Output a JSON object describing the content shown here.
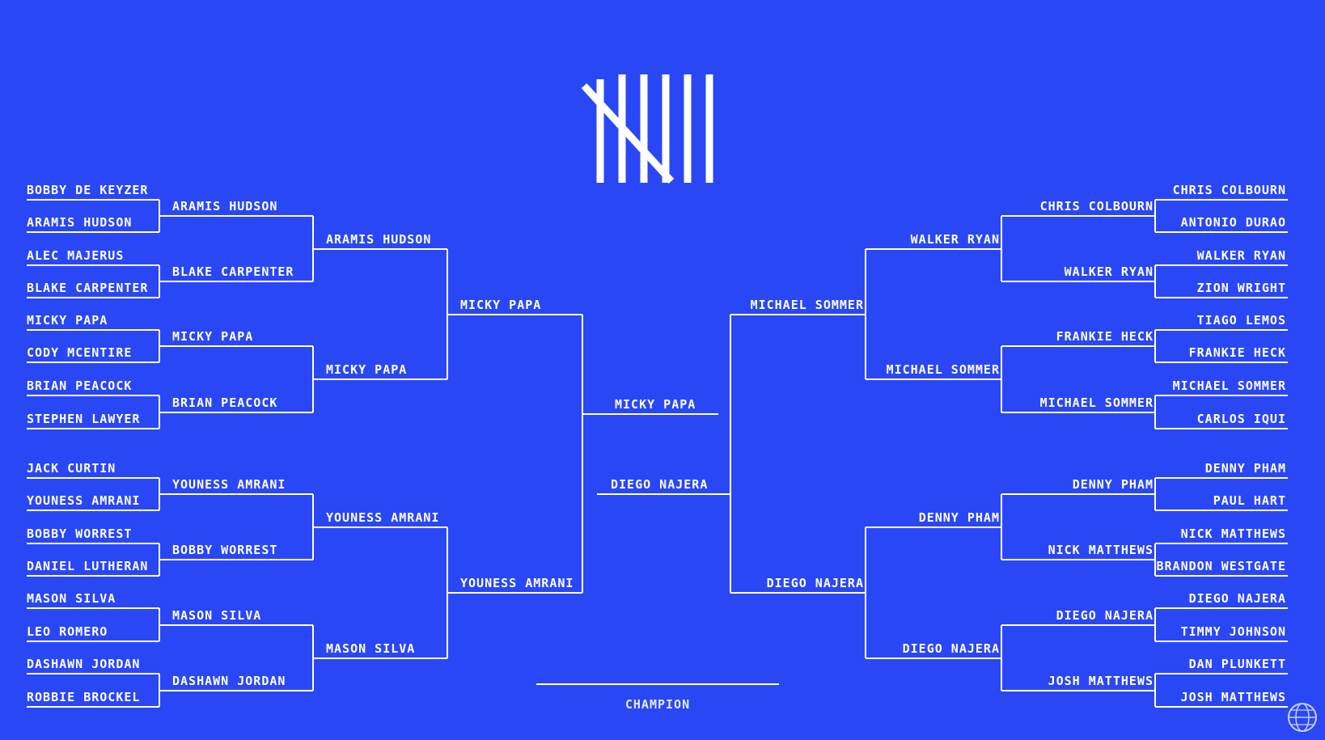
{
  "left": {
    "round1": [
      "BOBBY DE KEYZER",
      "ARAMIS HUDSON",
      "ALEC MAJERUS",
      "BLAKE CARPENTER",
      "MICKY PAPA",
      "CODY MCENTIRE",
      "BRIAN PEACOCK",
      "STEPHEN LAWYER",
      "JACK CURTIN",
      "YOUNESS AMRANI",
      "BOBBY WORREST",
      "DANIEL LUTHERAN",
      "MASON SILVA",
      "LEO ROMERO",
      "DASHAWN JORDAN",
      "ROBBIE BROCKEL"
    ],
    "round2": [
      "ARAMIS HUDSON",
      "BLAKE CARPENTER",
      "MICKY PAPA",
      "BRIAN PEACOCK",
      "YOUNESS AMRANI",
      "BOBBY WORREST",
      "MASON SILVA",
      "DASHAWN JORDAN"
    ],
    "round3": [
      "ARAMIS HUDSON",
      "MICKY PAPA",
      "YOUNESS AMRANI",
      "MASON SILVA"
    ],
    "round4": [
      "MICKY PAPA",
      "YOUNESS AMRANI"
    ]
  },
  "right": {
    "round1": [
      "CHRIS COLBOURN",
      "ANTONIO DURAO",
      "WALKER RYAN",
      "ZION WRIGHT",
      "TIAGO LEMOS",
      "FRANKIE HECK",
      "MICHAEL SOMMER",
      "CARLOS IQUI",
      "DENNY PHAM",
      "PAUL HART",
      "NICK MATTHEWS",
      "BRANDON WESTGATE",
      "DIEGO NAJERA",
      "TIMMY JOHNSON",
      "DAN PLUNKETT",
      "JOSH MATTHEWS"
    ],
    "round2": [
      "CHRIS COLBOURN",
      "WALKER RYAN",
      "FRANKIE HECK",
      "MICHAEL SOMMER",
      "DENNY PHAM",
      "NICK MATTHEWS",
      "DIEGO NAJERA",
      "JOSH MATTHEWS"
    ],
    "round3": [
      "WALKER RYAN",
      "MICHAEL SOMMER",
      "DENNY PHAM",
      "DIEGO NAJERA"
    ],
    "round4": [
      "MICHAEL SOMMER",
      "DIEGO NAJERA"
    ]
  },
  "final": {
    "left_finalist": "MICKY PAPA",
    "right_finalist": "DIEGO NAJERA",
    "champion_label": "CHAMPION"
  },
  "colors": {
    "background": "#2a47f5",
    "line": "#ffffff"
  }
}
